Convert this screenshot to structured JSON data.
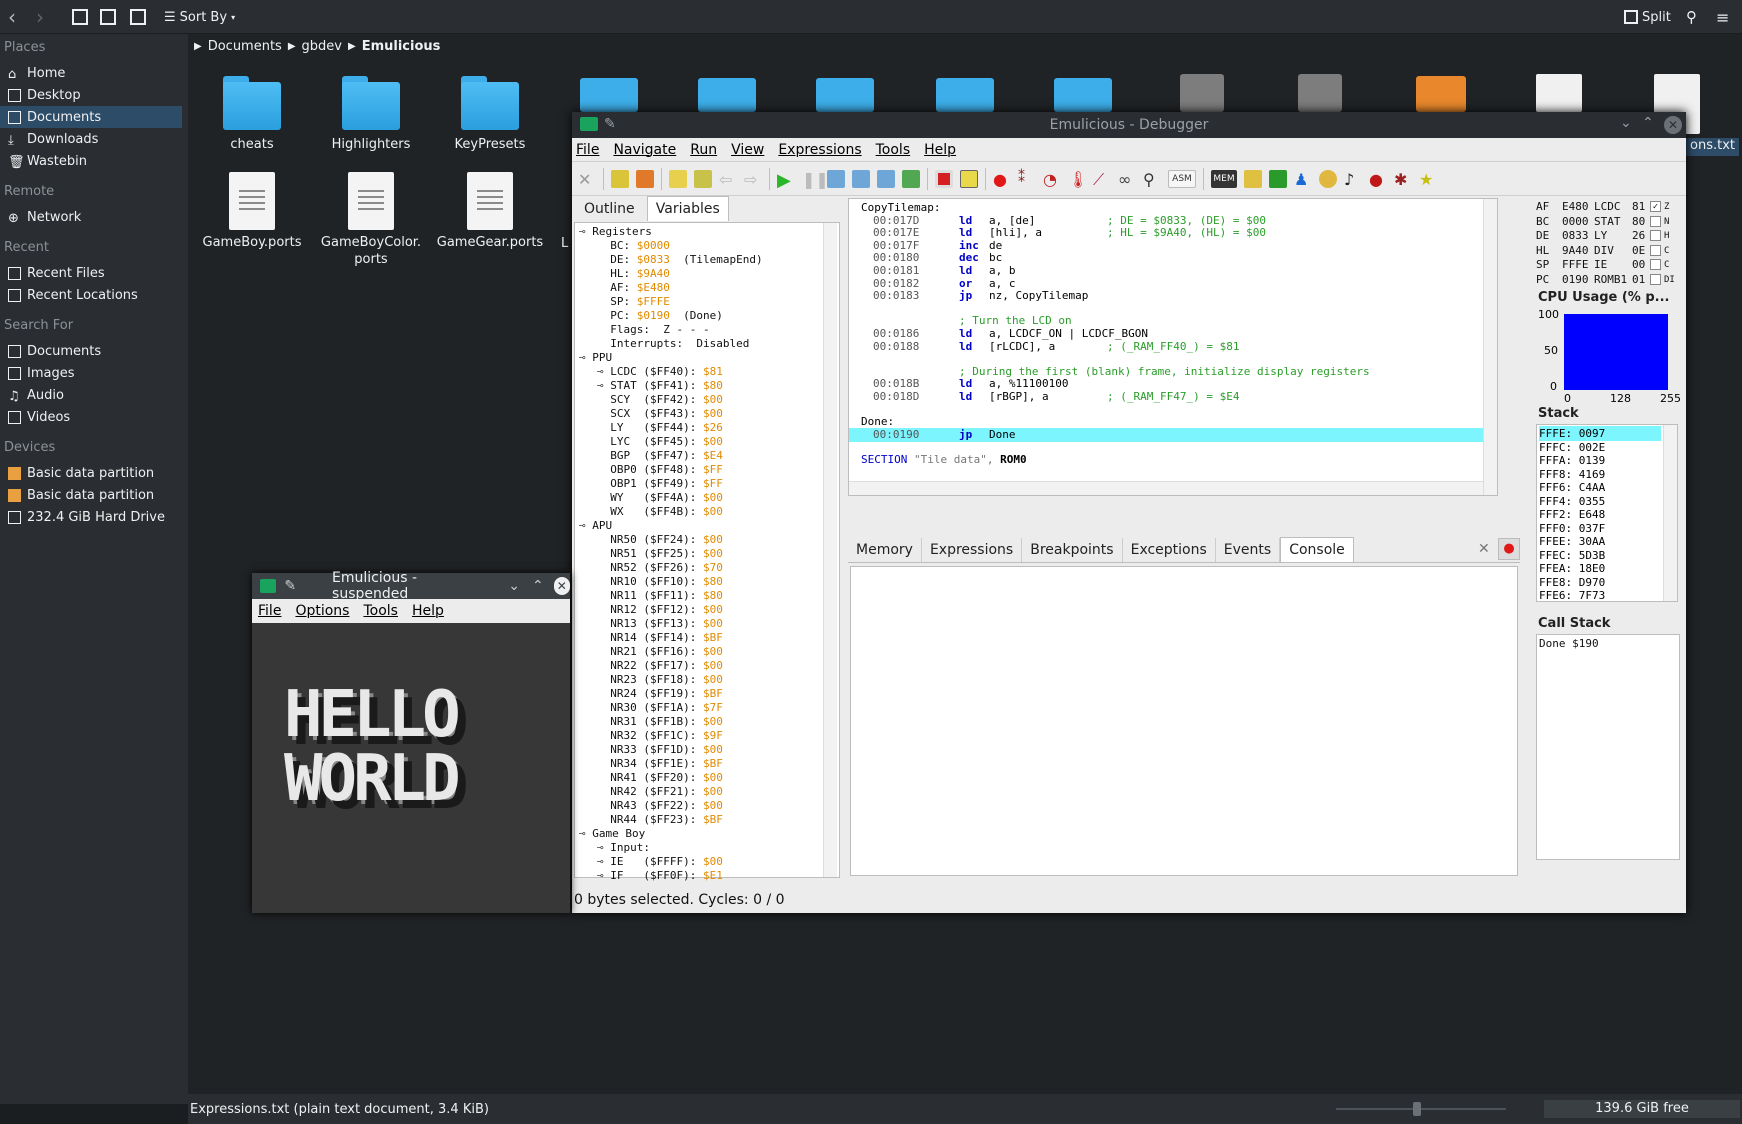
{
  "dolphin": {
    "sort_label": "Sort By",
    "split_label": "Split",
    "breadcrumb": [
      "Documents",
      "gbdev",
      "Emulicious"
    ],
    "sidebar": {
      "places_header": "Places",
      "places": [
        "Home",
        "Desktop",
        "Documents",
        "Downloads",
        "Wastebin"
      ],
      "remote_header": "Remote",
      "remote": [
        "Network"
      ],
      "recent_header": "Recent",
      "recent": [
        "Recent Files",
        "Recent Locations"
      ],
      "search_header": "Search For",
      "search": [
        "Documents",
        "Images",
        "Audio",
        "Videos"
      ],
      "devices_header": "Devices",
      "devices": [
        "Basic data partition",
        "Basic data partition",
        "232.4 GiB Hard Drive"
      ]
    },
    "files": {
      "cheats": "cheats",
      "highlighters": "Highlighters",
      "keypresets": "KeyPresets",
      "gameboy_ports": "GameBoy.ports",
      "gameboycolor_ports": "GameBoyColor.\nports",
      "gamegear_ports": "GameGear.ports",
      "partial_l": "L",
      "partial_txt": "ons.txt"
    },
    "status_text": "Expressions.txt (plain text document, 3.4 KiB)",
    "free_space": "139.6 GiB free",
    "zoom_level": 0.45
  },
  "emulator": {
    "title": "Emulicious - suspended",
    "menu": [
      "File",
      "Options",
      "Tools",
      "Help"
    ],
    "screen_text_line1": "HELLO",
    "screen_text_line2": "WORLD"
  },
  "debugger": {
    "title": "Emulicious - Debugger",
    "menu": [
      "File",
      "Navigate",
      "Run",
      "View",
      "Expressions",
      "Tools",
      "Help"
    ],
    "toolbar_asm": "ASM",
    "toolbar_mem": "MEM",
    "left_tabs": [
      "Outline",
      "Variables"
    ],
    "tree": [
      {
        "t": "Registers",
        "lvl": 0,
        "exp": true
      },
      {
        "t": "BC:",
        "v": "$0000",
        "lvl": 1
      },
      {
        "t": "DE:",
        "v": "$0833",
        "note": "(TilemapEnd)",
        "lvl": 1
      },
      {
        "t": "HL:",
        "v": "$9A40",
        "lvl": 1
      },
      {
        "t": "AF:",
        "v": "$E480",
        "lvl": 1
      },
      {
        "t": "SP:",
        "v": "$FFFE",
        "lvl": 1
      },
      {
        "t": "PC:",
        "v": "$0190",
        "note": "(Done)",
        "lvl": 1
      },
      {
        "t": "Flags:",
        "note": "Z - - -",
        "lvl": 1
      },
      {
        "t": "Interrupts:",
        "note": "Disabled",
        "lvl": 1
      },
      {
        "t": "PPU",
        "lvl": 0,
        "exp": true
      },
      {
        "t": "LCDC ($FF40):",
        "v": "$81",
        "lvl": 1,
        "exp": true
      },
      {
        "t": "STAT ($FF41):",
        "v": "$80",
        "lvl": 1,
        "exp": true
      },
      {
        "t": "SCY  ($FF42):",
        "v": "$00",
        "lvl": 1
      },
      {
        "t": "SCX  ($FF43):",
        "v": "$00",
        "lvl": 1
      },
      {
        "t": "LY   ($FF44):",
        "v": "$26",
        "lvl": 1
      },
      {
        "t": "LYC  ($FF45):",
        "v": "$00",
        "lvl": 1
      },
      {
        "t": "BGP  ($FF47):",
        "v": "$E4",
        "lvl": 1
      },
      {
        "t": "OBP0 ($FF48):",
        "v": "$FF",
        "lvl": 1
      },
      {
        "t": "OBP1 ($FF49):",
        "v": "$FF",
        "lvl": 1
      },
      {
        "t": "WY   ($FF4A):",
        "v": "$00",
        "lvl": 1
      },
      {
        "t": "WX   ($FF4B):",
        "v": "$00",
        "lvl": 1
      },
      {
        "t": "APU",
        "lvl": 0,
        "exp": true
      },
      {
        "t": "NR50 ($FF24):",
        "v": "$00",
        "lvl": 1
      },
      {
        "t": "NR51 ($FF25):",
        "v": "$00",
        "lvl": 1
      },
      {
        "t": "NR52 ($FF26):",
        "v": "$70",
        "lvl": 1
      },
      {
        "t": "NR10 ($FF10):",
        "v": "$80",
        "lvl": 1
      },
      {
        "t": "NR11 ($FF11):",
        "v": "$80",
        "lvl": 1
      },
      {
        "t": "NR12 ($FF12):",
        "v": "$00",
        "lvl": 1
      },
      {
        "t": "NR13 ($FF13):",
        "v": "$00",
        "lvl": 1
      },
      {
        "t": "NR14 ($FF14):",
        "v": "$BF",
        "lvl": 1
      },
      {
        "t": "NR21 ($FF16):",
        "v": "$00",
        "lvl": 1
      },
      {
        "t": "NR22 ($FF17):",
        "v": "$00",
        "lvl": 1
      },
      {
        "t": "NR23 ($FF18):",
        "v": "$00",
        "lvl": 1
      },
      {
        "t": "NR24 ($FF19):",
        "v": "$BF",
        "lvl": 1
      },
      {
        "t": "NR30 ($FF1A):",
        "v": "$7F",
        "lvl": 1
      },
      {
        "t": "NR31 ($FF1B):",
        "v": "$00",
        "lvl": 1
      },
      {
        "t": "NR32 ($FF1C):",
        "v": "$9F",
        "lvl": 1
      },
      {
        "t": "NR33 ($FF1D):",
        "v": "$00",
        "lvl": 1
      },
      {
        "t": "NR34 ($FF1E):",
        "v": "$BF",
        "lvl": 1
      },
      {
        "t": "NR41 ($FF20):",
        "v": "$00",
        "lvl": 1
      },
      {
        "t": "NR42 ($FF21):",
        "v": "$00",
        "lvl": 1
      },
      {
        "t": "NR43 ($FF22):",
        "v": "$00",
        "lvl": 1
      },
      {
        "t": "NR44 ($FF23):",
        "v": "$BF",
        "lvl": 1
      },
      {
        "t": "Game Boy",
        "lvl": 0,
        "exp": true
      },
      {
        "t": "Input:",
        "lvl": 1,
        "exp": true
      },
      {
        "t": "IE   ($FFFF):",
        "v": "$00",
        "lvl": 1,
        "exp": true
      },
      {
        "t": "IF   ($FF0F):",
        "v": "$E1",
        "lvl": 1,
        "exp": true
      }
    ],
    "code": [
      {
        "label": "CopyTilemap:"
      },
      {
        "addr": "00:017D",
        "op": "ld",
        "args": "a, [de]",
        "cm": "; DE = $0833, (DE) = $00"
      },
      {
        "addr": "00:017E",
        "op": "ld",
        "args": "[hli], a",
        "cm": "; HL = $9A40, (HL) = $00"
      },
      {
        "addr": "00:017F",
        "op": "inc",
        "args": "de"
      },
      {
        "addr": "00:0180",
        "op": "dec",
        "args": "bc"
      },
      {
        "addr": "00:0181",
        "op": "ld",
        "args": "a, b"
      },
      {
        "addr": "00:0182",
        "op": "or",
        "args": "a, c"
      },
      {
        "addr": "00:0183",
        "op": "jp",
        "args": "nz, CopyTilemap"
      },
      {},
      {
        "cmonly": "; Turn the LCD on"
      },
      {
        "addr": "00:0186",
        "op": "ld",
        "args": "a, LCDCF_ON | LCDCF_BGON"
      },
      {
        "addr": "00:0188",
        "op": "ld",
        "args": "[rLCDC], a",
        "cm": "; (_RAM_FF40_) = $81"
      },
      {},
      {
        "cmonly": "; During the first (blank) frame, initialize display registers"
      },
      {
        "addr": "00:018B",
        "op": "ld",
        "args": "a, %11100100"
      },
      {
        "addr": "00:018D",
        "op": "ld",
        "args": "[rBGP], a",
        "cm": "; (_RAM_FF47_) = $E4"
      },
      {},
      {
        "label": "Done:"
      },
      {
        "addr": "00:0190",
        "op": "jp",
        "args": "Done",
        "current": true
      },
      {},
      {
        "section": "SECTION",
        "str": "\"Tile data\",",
        "rom": "ROM0"
      }
    ],
    "bottom_tabs": [
      "Memory",
      "Expressions",
      "Breakpoints",
      "Exceptions",
      "Events",
      "Console"
    ],
    "registers": [
      {
        "r": "AF",
        "v": "E480",
        "io": "LCDC",
        "iv": "81",
        "f": "Z",
        "chk": true
      },
      {
        "r": "BC",
        "v": "0000",
        "io": "STAT",
        "iv": "80",
        "f": "N",
        "chk": false
      },
      {
        "r": "DE",
        "v": "0833",
        "io": "LY",
        "iv": "26",
        "f": "H",
        "chk": false
      },
      {
        "r": "HL",
        "v": "9A40",
        "io": "DIV",
        "iv": "0E",
        "f": "C",
        "chk": false
      },
      {
        "r": "SP",
        "v": "FFFE",
        "io": "IE",
        "iv": "00",
        "f": "C",
        "chk": false
      },
      {
        "r": "PC",
        "v": "0190",
        "io": "ROMB1",
        "iv": "01",
        "f": "DI",
        "chk": false
      }
    ],
    "cpu_usage": {
      "title": "CPU Usage (% p...",
      "y_ticks": [
        "100",
        "50",
        "0"
      ],
      "x_ticks": [
        "0",
        "128",
        "255"
      ],
      "fill_percent": 100
    },
    "stack_title": "Stack",
    "stack": [
      [
        "FFFE:",
        "0097"
      ],
      [
        "FFFC:",
        "002E"
      ],
      [
        "FFFA:",
        "0139"
      ],
      [
        "FFF8:",
        "4169"
      ],
      [
        "FFF6:",
        "C4AA"
      ],
      [
        "FFF4:",
        "0355"
      ],
      [
        "FFF2:",
        "E648"
      ],
      [
        "FFF0:",
        "037F"
      ],
      [
        "FFEE:",
        "30AA"
      ],
      [
        "FFEC:",
        "5D3B"
      ],
      [
        "FFEA:",
        "18E0"
      ],
      [
        "FFE8:",
        "D970"
      ],
      [
        "FFE6:",
        "7F73"
      ]
    ],
    "callstack_title": "Call Stack",
    "callstack": [
      "Done $190"
    ],
    "status": "0 bytes selected. Cycles: 0 / 0"
  }
}
